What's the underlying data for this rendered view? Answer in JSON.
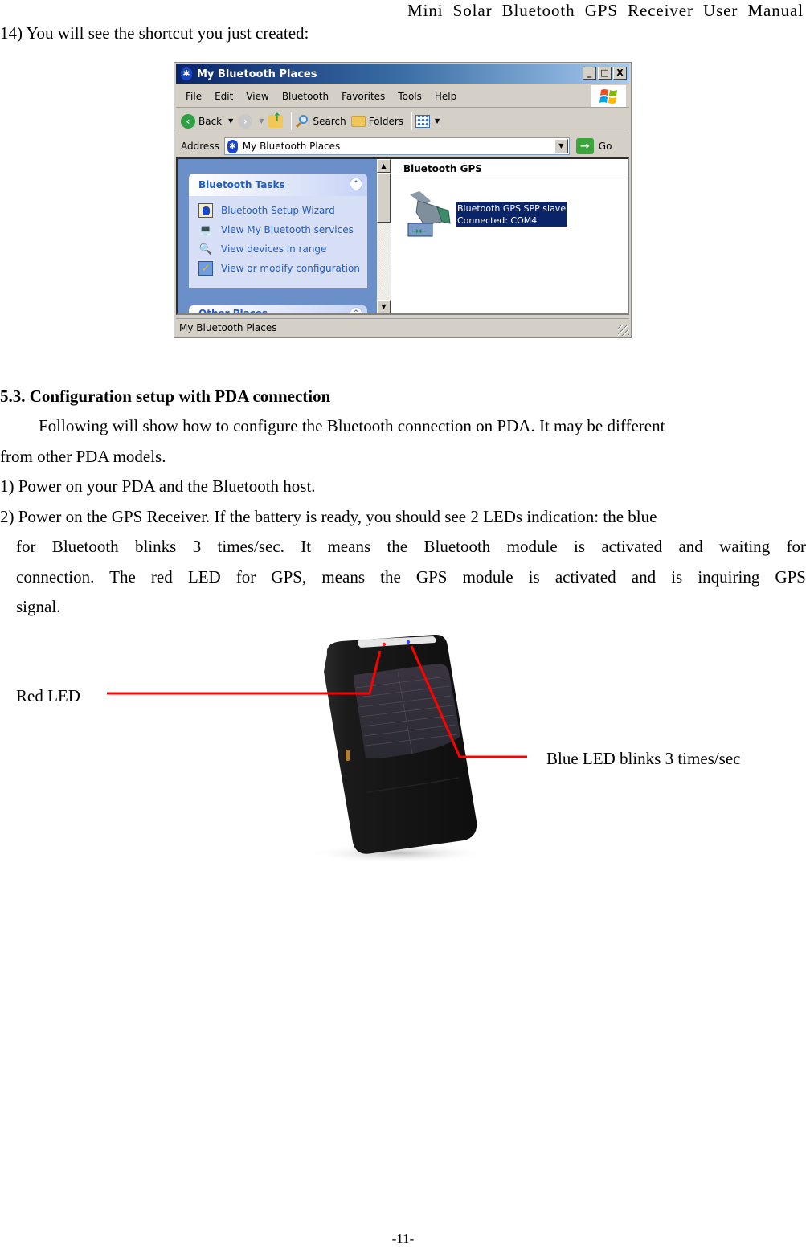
{
  "header": {
    "title": "Mini Solar Bluetooth GPS Receiver User Manual"
  },
  "step14": {
    "text": "14) You will see the shortcut you just created:"
  },
  "window": {
    "title": "My Bluetooth Places",
    "controls": {
      "minimize": "_",
      "maximize": "□",
      "close": "X"
    },
    "menu": [
      "File",
      "Edit",
      "View",
      "Bluetooth",
      "Favorites",
      "Tools",
      "Help"
    ],
    "toolbar": {
      "back": "Back",
      "search": "Search",
      "folders": "Folders"
    },
    "address": {
      "label": "Address",
      "value": "My Bluetooth Places",
      "go": "Go"
    },
    "task_pane": {
      "title": "Bluetooth Tasks",
      "items": [
        {
          "label": "Bluetooth Setup Wizard",
          "icon": "wizard-icon"
        },
        {
          "label": "View My Bluetooth services",
          "icon": "laptop-icon"
        },
        {
          "label": "View devices in range",
          "icon": "magnifier-icon"
        },
        {
          "label": "View or modify configuration",
          "icon": "configuration-icon"
        }
      ],
      "other_places": "Other Places"
    },
    "group_header": "Bluetooth GPS",
    "device": {
      "name": "Bluetooth GPS SPP slave",
      "status": "Connected: COM4"
    },
    "status_bar": "My Bluetooth Places"
  },
  "section": {
    "heading": "5.3. Configuration setup with PDA connection",
    "intro_line1": "Following will show how to configure the Bluetooth connection on PDA. It may be different",
    "intro_line2": "from other PDA models.",
    "step1": "1) Power on your PDA and the Bluetooth host.",
    "step2_line1": "2) Power on the GPS Receiver. If the battery is ready, you should see 2 LEDs indication: the blue",
    "step2_line2": "for Bluetooth blinks 3 times/sec. It means the Bluetooth module is activated and waiting for",
    "step2_line3": "connection. The red LED for GPS, means the GPS module is activated and is inquiring GPS",
    "step2_line4": "signal."
  },
  "figure": {
    "red_label": "Red LED",
    "blue_label": "Blue LED blinks 3 times/sec",
    "callout_color": "#ff0000"
  },
  "footer": {
    "page": "-11-"
  }
}
